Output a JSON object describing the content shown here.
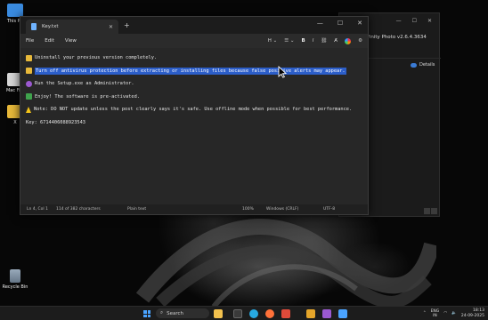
{
  "desktop": {
    "icons": [
      {
        "label": "This PC"
      },
      {
        "label": "Mac File"
      },
      {
        "label": "X"
      },
      {
        "label": "Recycle Bin"
      }
    ]
  },
  "background_window": {
    "title": "ffinity Photo v2.6.4.3634",
    "details_label": "Details",
    "minimize": "—",
    "maximize": "☐",
    "close": "✕"
  },
  "notepad": {
    "tab_title": "Key.txt",
    "tab_close": "✕",
    "new_tab": "+",
    "window_controls": {
      "minimize": "—",
      "maximize": "☐",
      "close": "✕"
    },
    "menu": [
      "File",
      "Edit",
      "View"
    ],
    "toolbar": {
      "heading": "H ⌄",
      "list": "☰ ⌄",
      "bold": "B",
      "italic": "I",
      "link": "⛓",
      "clear_format": "A̸",
      "settings": "⚙"
    },
    "lines": [
      {
        "emoji_color": "#e8b93a",
        "text": "Uninstall your previous version completely.",
        "selected": false
      },
      {
        "emoji_color": "#e8b93a",
        "text": "Turn off antivirus protection before extracting or installing files because false positive alerts may appear.",
        "selected": true
      },
      {
        "emoji_color": "#9b59d0",
        "text": "Run the Setup.exe as Administrator.",
        "selected": false
      },
      {
        "emoji_color": "#3fa34d",
        "text": "Enjoy! The software is pre-activated.",
        "selected": false
      },
      {
        "emoji_color": "warning",
        "text": "Note: DO NOT update unless the post clearly says it's safe. Use offline mode when possible for best performance.",
        "selected": false
      },
      {
        "emoji_color": "",
        "text": "Key: 6714406088923543",
        "selected": false
      }
    ],
    "status": {
      "position": "Ln 4, Col 1",
      "selection": "114 of 382 characters",
      "format": "Plain text",
      "zoom": "100%",
      "line_ending": "Windows (CRLF)",
      "encoding": "UTF-8"
    }
  },
  "taskbar": {
    "search_placeholder": "Search",
    "apps": [
      {
        "name": "file-explorer",
        "color": "#f2c14e"
      },
      {
        "name": "terminal",
        "color": "#3a3a3a"
      },
      {
        "name": "edge",
        "color": "#27a9e1"
      },
      {
        "name": "firefox",
        "color": "#ff7139"
      },
      {
        "name": "store",
        "color": "#e04a3a"
      },
      {
        "name": "rh-app",
        "color": "#e5a52a"
      },
      {
        "name": "photos",
        "color": "#9b59d0"
      },
      {
        "name": "notepad",
        "color": "#4aa3ff"
      }
    ],
    "tray": {
      "lang": "ENG",
      "region": "IN",
      "time": "18:13",
      "date": "24-09-2025"
    }
  },
  "colors": {
    "selection": "#2c5ec9",
    "accent": "#4aa3ff"
  }
}
